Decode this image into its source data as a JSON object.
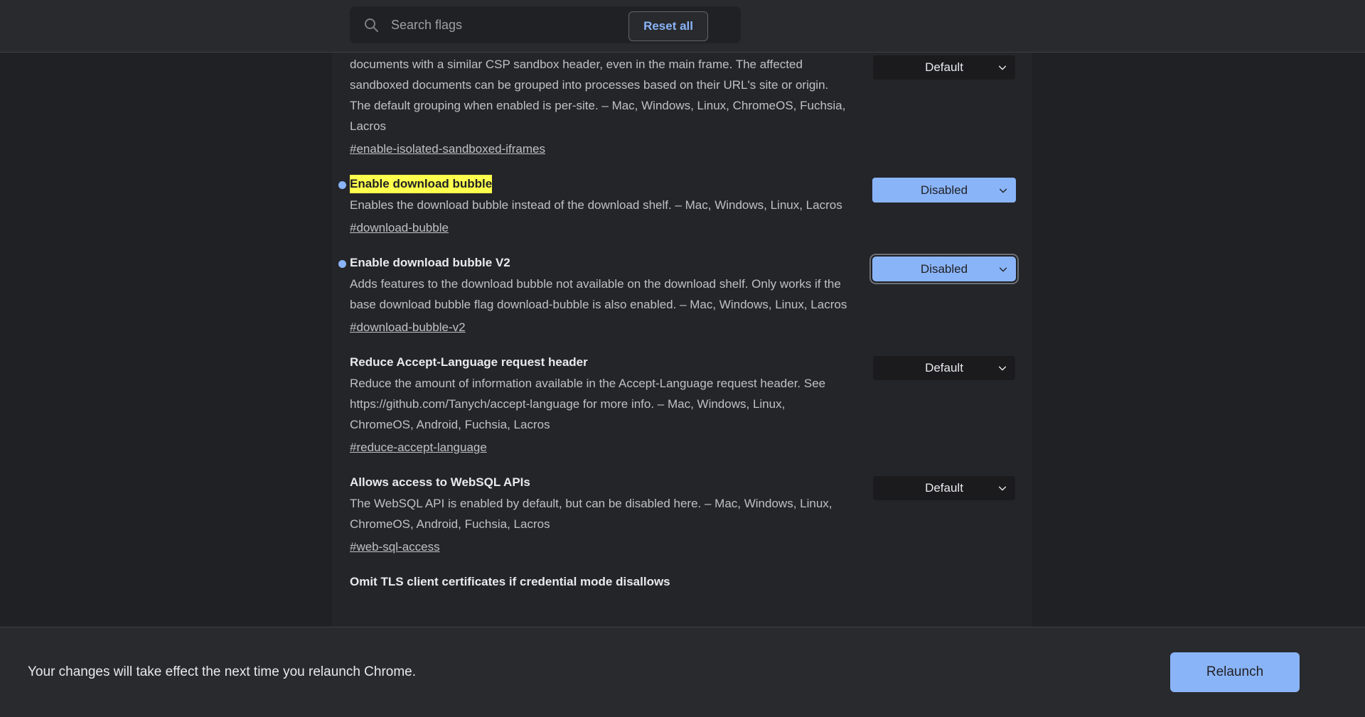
{
  "header": {
    "search": {
      "placeholder": "Search flags",
      "value": "",
      "icon": "search-icon"
    },
    "reset_all_label": "Reset all"
  },
  "colors": {
    "accent": "#8ab4f8",
    "highlight": "#ffff4d",
    "page_bg": "#202124",
    "panel_bg": "#242528",
    "bar_bg": "#292a2d",
    "text": "#e8eaed",
    "muted_text": "#bdc1c6"
  },
  "flags": [
    {
      "title": "",
      "modified": false,
      "highlighted": false,
      "partial_top": true,
      "description": "documents with a similar CSP sandbox header, even in the main frame. The affected sandboxed documents can be grouped into processes based on their URL's site or origin. The default grouping when enabled is per-site. – Mac, Windows, Linux, ChromeOS, Fuchsia, Lacros",
      "link": "#enable-isolated-sandboxed-iframes",
      "select": {
        "value": "Default",
        "state": "default",
        "focused": false
      }
    },
    {
      "title": "Enable download bubble",
      "modified": true,
      "highlighted": true,
      "partial_top": false,
      "description": "Enables the download bubble instead of the download shelf. – Mac, Windows, Linux, Lacros",
      "link": "#download-bubble",
      "select": {
        "value": "Disabled",
        "state": "modified",
        "focused": false
      }
    },
    {
      "title": "Enable download bubble V2",
      "modified": true,
      "highlighted": false,
      "partial_top": false,
      "description": "Adds features to the download bubble not available on the download shelf. Only works if the base download bubble flag download-bubble is also enabled. – Mac, Windows, Linux, Lacros",
      "link": "#download-bubble-v2",
      "select": {
        "value": "Disabled",
        "state": "modified",
        "focused": true
      }
    },
    {
      "title": "Reduce Accept-Language request header",
      "modified": false,
      "highlighted": false,
      "partial_top": false,
      "description": "Reduce the amount of information available in the Accept-Language request header. See https://github.com/Tanych/accept-language for more info. – Mac, Windows, Linux, ChromeOS, Android, Fuchsia, Lacros",
      "link": "#reduce-accept-language",
      "select": {
        "value": "Default",
        "state": "default",
        "focused": false
      }
    },
    {
      "title": "Allows access to WebSQL APIs",
      "modified": false,
      "highlighted": false,
      "partial_top": false,
      "description": "The WebSQL API is enabled by default, but can be disabled here. – Mac, Windows, Linux, ChromeOS, Android, Fuchsia, Lacros",
      "link": "#web-sql-access",
      "select": {
        "value": "Default",
        "state": "default",
        "focused": false
      }
    },
    {
      "title": "Omit TLS client certificates if credential mode disallows",
      "modified": false,
      "highlighted": false,
      "partial_top": false,
      "description": "",
      "link": "",
      "select": null
    }
  ],
  "relaunch_bar": {
    "message": "Your changes will take effect the next time you relaunch Chrome.",
    "button_label": "Relaunch"
  }
}
